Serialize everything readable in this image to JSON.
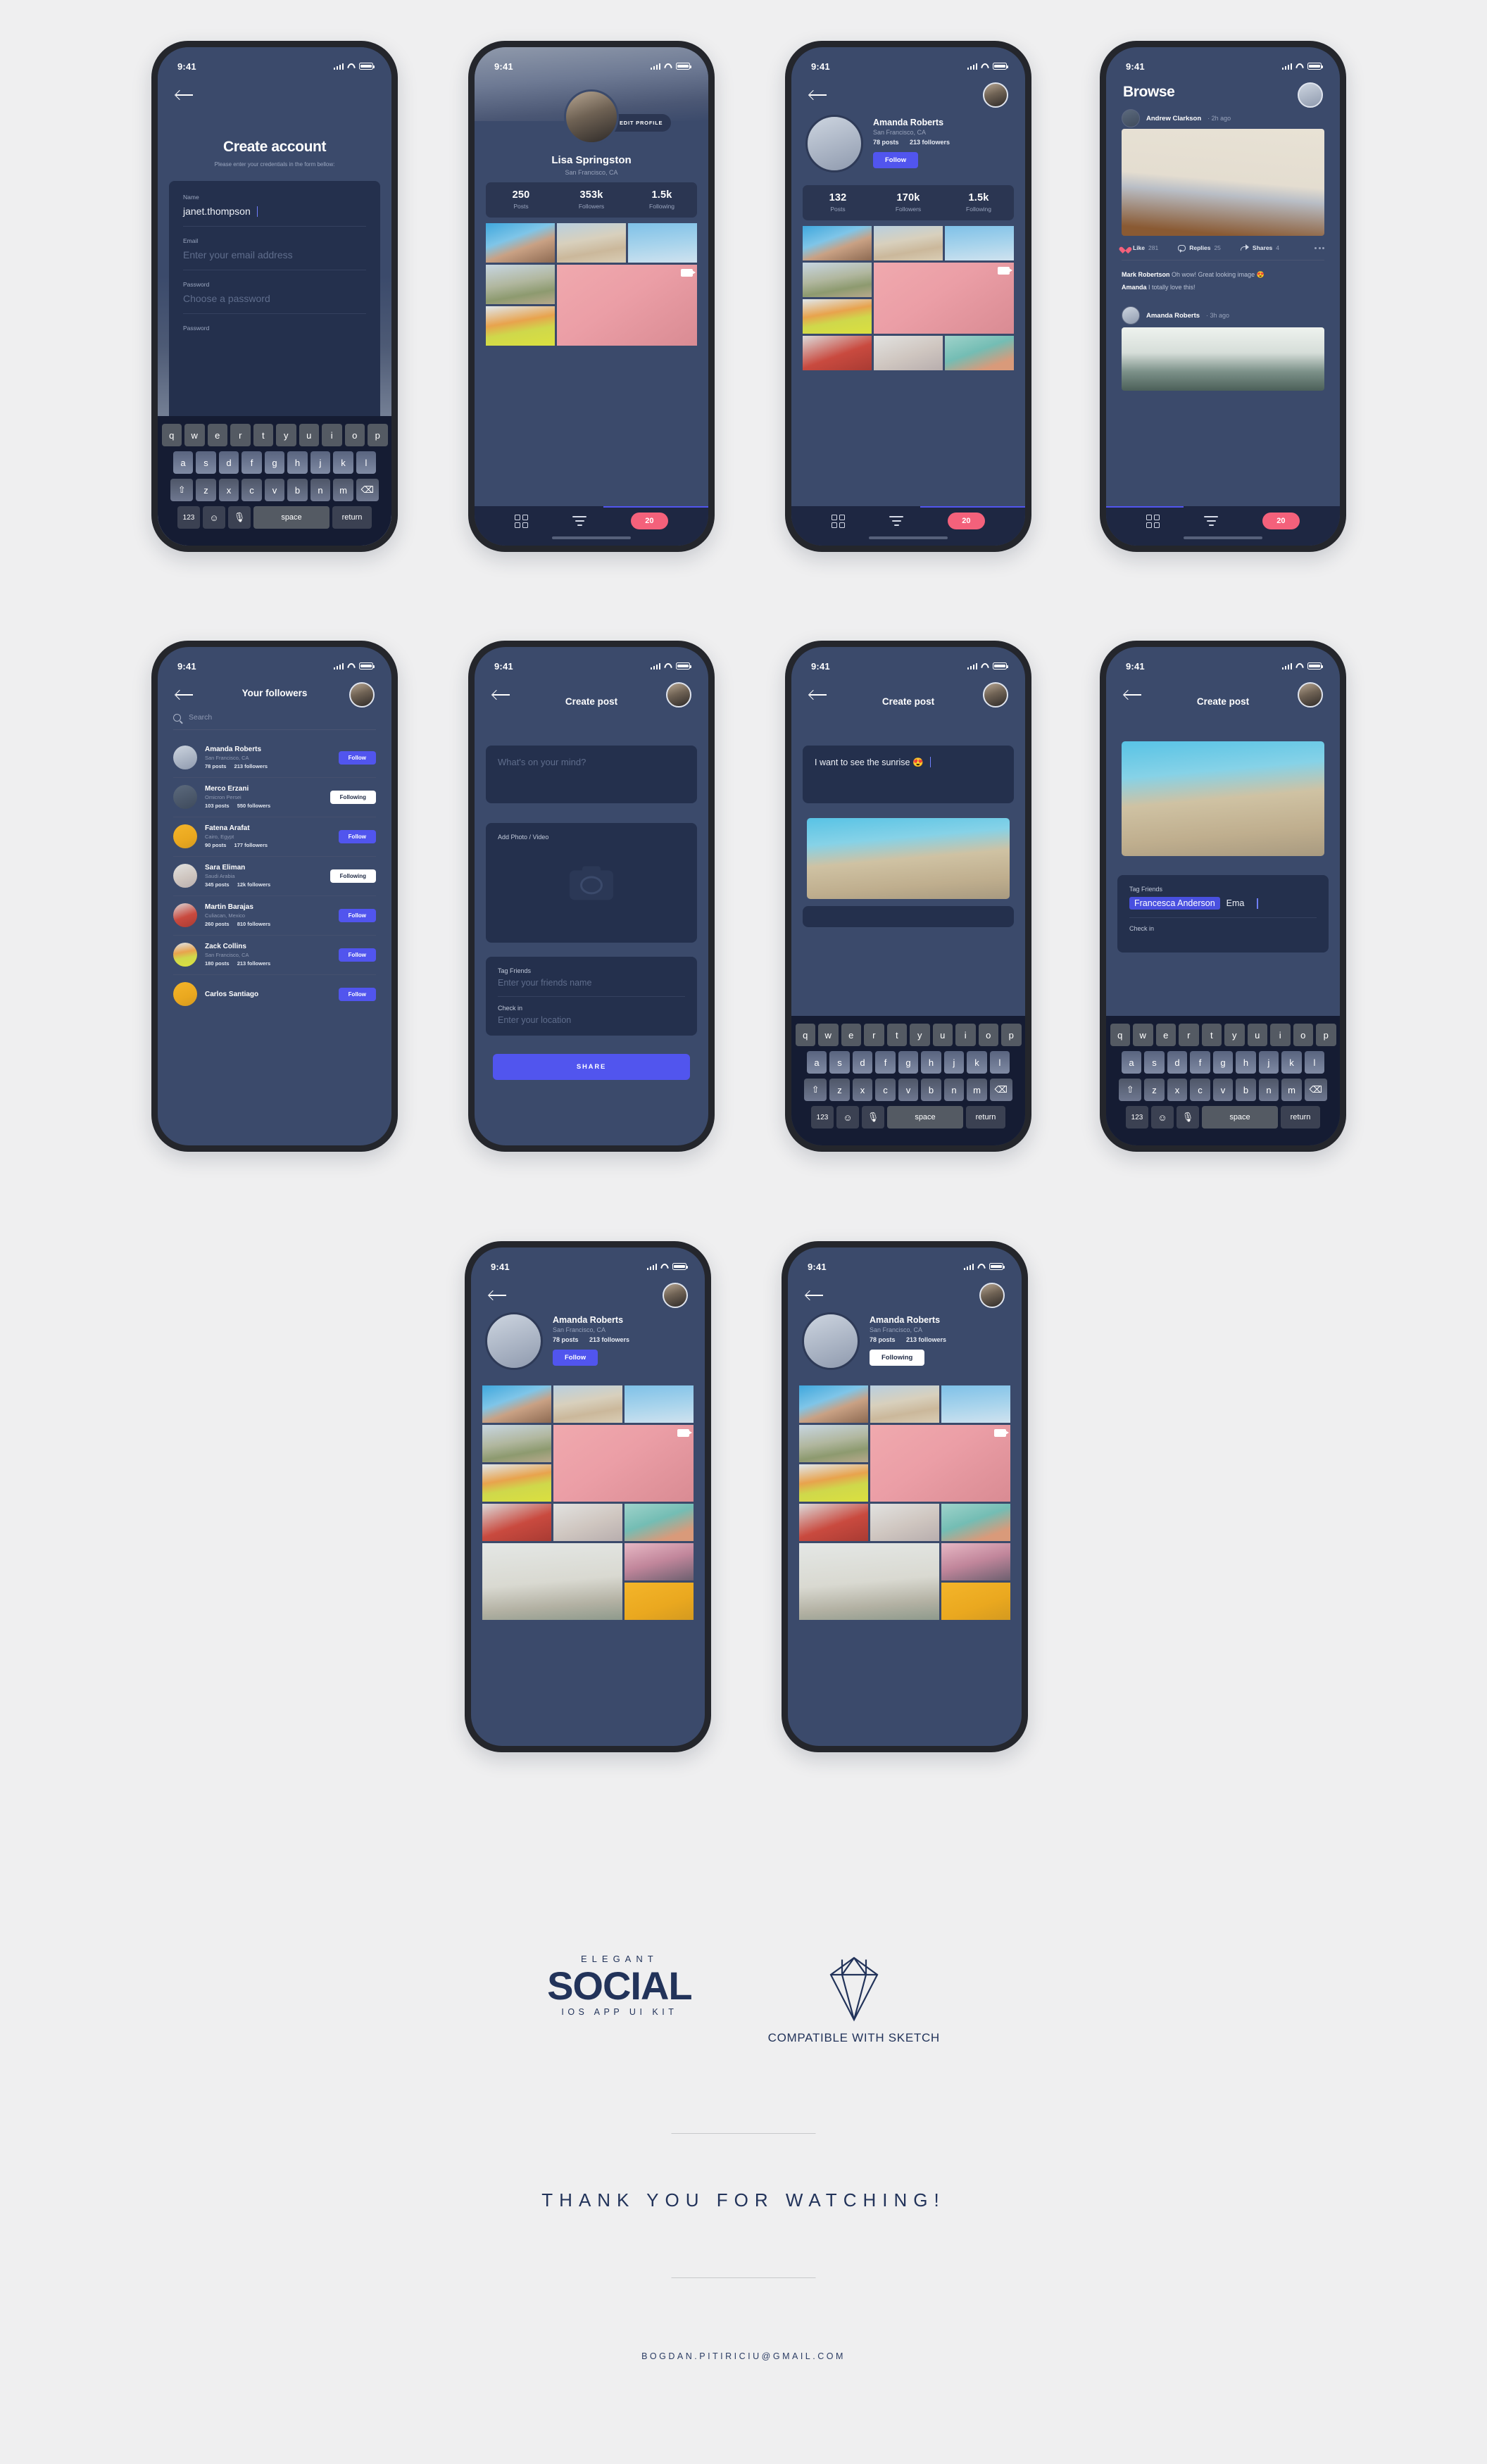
{
  "meta": {
    "status_time": "9:41"
  },
  "colors": {
    "page_bg": "#efeff0",
    "screen_bg": "#3b4a6b",
    "card_bg": "#24304d",
    "accent_blue": "#5155ee",
    "accent_pink": "#f4617b",
    "brand_navy": "#22335a"
  },
  "screens": {
    "create_account": {
      "title": "Create account",
      "subtitle": "Please enter your credentials in the form bellow:",
      "fields": [
        {
          "label": "Name",
          "value": "janet.thompson",
          "placeholder": ""
        },
        {
          "label": "Email",
          "value": "",
          "placeholder": "Enter your email address"
        },
        {
          "label": "Password",
          "value": "",
          "placeholder": "Choose a password"
        },
        {
          "label": "Password",
          "value": "",
          "placeholder": ""
        }
      ]
    },
    "profile_own": {
      "edit_button": "EDIT PROFILE",
      "name": "Lisa Springston",
      "location": "San Francisco, CA",
      "stats": [
        {
          "num": "250",
          "label": "Posts"
        },
        {
          "num": "353k",
          "label": "Followers"
        },
        {
          "num": "1.5k",
          "label": "Following"
        }
      ]
    },
    "profile_amanda": {
      "name": "Amanda Roberts",
      "location": "San Francisco, CA",
      "posts": "78 posts",
      "followers": "213 followers",
      "follow_button": "Follow",
      "following_button": "Following",
      "stats": [
        {
          "num": "132",
          "label": "Posts"
        },
        {
          "num": "170k",
          "label": "Followers"
        },
        {
          "num": "1.5k",
          "label": "Following"
        }
      ]
    },
    "browse": {
      "title": "Browse",
      "posts": [
        {
          "author": "Andrew Clarkson",
          "time": "2h ago"
        },
        {
          "author": "Amanda Roberts",
          "time": "3h ago"
        }
      ],
      "actions": [
        {
          "label": "Like",
          "count": "281"
        },
        {
          "label": "Replies",
          "count": "25"
        },
        {
          "label": "Shares",
          "count": "4"
        }
      ],
      "comments": [
        {
          "author": "Mark Robertson",
          "text": "Oh wow! Great looking image 😍"
        },
        {
          "author": "Amanda",
          "text": "I totally love this!"
        }
      ]
    },
    "followers": {
      "title": "Your followers",
      "search_placeholder": "Search",
      "list": [
        {
          "name": "Amanda Roberts",
          "location": "San Francisco, CA",
          "posts": "78 posts",
          "followers": "213 followers",
          "button": "Follow",
          "following": false
        },
        {
          "name": "Merco Erzani",
          "location": "Omicron Persei",
          "posts": "103 posts",
          "followers": "550 followers",
          "button": "Following",
          "following": true
        },
        {
          "name": "Fatena Arafat",
          "location": "Cairo, Egypt",
          "posts": "90 posts",
          "followers": "177 followers",
          "button": "Follow",
          "following": false
        },
        {
          "name": "Sara Eliman",
          "location": "Saudi Arabia",
          "posts": "345 posts",
          "followers": "12k followers",
          "button": "Following",
          "following": true
        },
        {
          "name": "Martin Barajas",
          "location": "Culiacan, Mexico",
          "posts": "260 posts",
          "followers": "810 followers",
          "button": "Follow",
          "following": false
        },
        {
          "name": "Zack Collins",
          "location": "San Francisco, CA",
          "posts": "180 posts",
          "followers": "213 followers",
          "button": "Follow",
          "following": false
        },
        {
          "name": "Carlos Santiago",
          "location": "",
          "posts": "",
          "followers": "",
          "button": "Follow",
          "following": false
        }
      ]
    },
    "create_post": {
      "title": "Create post",
      "message_placeholder": "What's on your mind?",
      "message_value": "I want to see the sunrise 😍",
      "media_label": "Add Photo / Video",
      "tag_label": "Tag Friends",
      "tag_placeholder": "Enter your friends name",
      "tag_chip": "Francesca Anderson",
      "tag_typed": "Ema",
      "checkin_label": "Check in",
      "checkin_placeholder": "Enter your location",
      "share_button": "SHARE"
    },
    "bottom_nav": {
      "grid_icon": "grid-icon",
      "filter_icon": "filter-icon",
      "badge": "20"
    },
    "keyboard": {
      "row1": [
        "q",
        "w",
        "e",
        "r",
        "t",
        "y",
        "u",
        "i",
        "o",
        "p"
      ],
      "row2": [
        "a",
        "s",
        "d",
        "f",
        "g",
        "h",
        "j",
        "k",
        "l"
      ],
      "row3": [
        "z",
        "x",
        "c",
        "v",
        "b",
        "n",
        "m"
      ],
      "shift": "⇧",
      "backspace": "⌫",
      "num": "123",
      "emoji": "☺",
      "mic": "🎤",
      "space": "space",
      "return": "return"
    }
  },
  "footer": {
    "elegant": "ELEGANT",
    "social": "SOCIAL",
    "kit": "IOS APP UI KIT",
    "sketch_caption": "COMPATIBLE WITH SKETCH",
    "diamond_icon": "diamond-icon",
    "thanks": "THANK YOU FOR WATCHING!",
    "email": "BOGDAN.PITIRICIU@GMAIL.COM"
  }
}
